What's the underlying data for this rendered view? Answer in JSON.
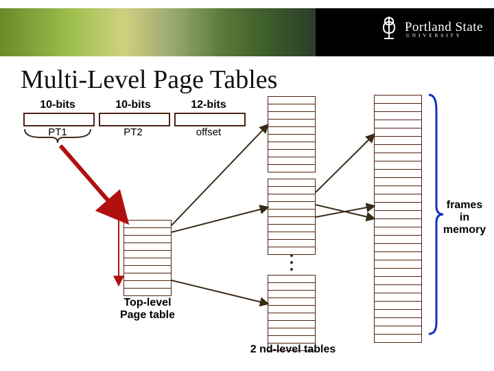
{
  "university": {
    "name": "Portland State",
    "subtitle": "UNIVERSITY"
  },
  "slide_title": "Multi-Level Page Tables",
  "va_fields": [
    {
      "bits": "10-bits",
      "name": "PT1"
    },
    {
      "bits": "10-bits",
      "name": "PT2"
    },
    {
      "bits": "12-bits",
      "name": "offset"
    }
  ],
  "labels": {
    "top_level": "Top-level\nPage table",
    "second_level": "2 nd-level tables",
    "frames": "frames\nin\nmemory"
  },
  "tables": {
    "top_level_rows": 10,
    "second_level_rows": 10,
    "second_level_count": 3,
    "frames_rows": 30
  },
  "colors": {
    "box_border": "#4a2210",
    "arrow_red": "#b01010",
    "bracket_blue": "#1030c0"
  }
}
